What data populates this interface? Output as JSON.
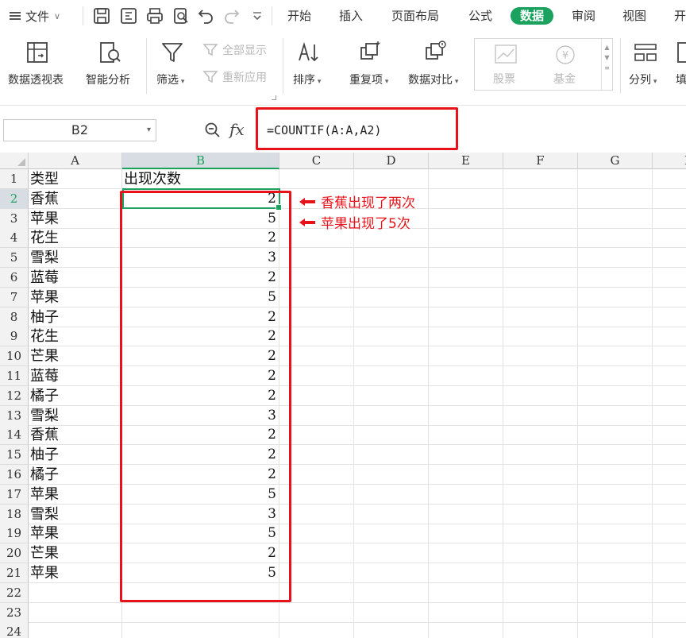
{
  "menubar": {
    "file_label": "文件",
    "tabs": [
      {
        "label": "开始",
        "active": false
      },
      {
        "label": "插入",
        "active": false
      },
      {
        "label": "页面布局",
        "active": false
      },
      {
        "label": "公式",
        "active": false
      },
      {
        "label": "数据",
        "active": true
      },
      {
        "label": "审阅",
        "active": false
      },
      {
        "label": "视图",
        "active": false
      },
      {
        "label": "开",
        "active": false
      }
    ],
    "quick_access_icons": [
      "save-icon",
      "export-icon",
      "print-icon",
      "print-preview-icon",
      "undo-icon",
      "redo-icon",
      "customize-icon"
    ]
  },
  "ribbon": {
    "pivot_label": "数据透视表",
    "smart_analysis_label": "智能分析",
    "filter_label": "筛选",
    "show_all_label": "全部显示",
    "reapply_label": "重新应用",
    "sort_label": "排序",
    "duplicates_label": "重复项",
    "compare_label": "数据对比",
    "stock_label": "股票",
    "fund_label": "基金",
    "split_label": "分列",
    "fill_label": "填"
  },
  "formula_bar": {
    "name_box": "B2",
    "fx_label": "fx",
    "formula": "=COUNTIF(A:A,A2)"
  },
  "sheet": {
    "columns": [
      "A",
      "B",
      "C",
      "D",
      "E",
      "F",
      "G",
      "H"
    ],
    "row_numbers": [
      "1",
      "2",
      "3",
      "4",
      "5",
      "6",
      "7",
      "8",
      "9",
      "10",
      "11",
      "12",
      "13",
      "14",
      "15",
      "16",
      "17",
      "18",
      "19",
      "20",
      "21",
      "22",
      "23",
      "24"
    ],
    "header": {
      "a": "类型",
      "b": "出现次数"
    },
    "rows": [
      {
        "a": "香蕉",
        "b": "2"
      },
      {
        "a": "苹果",
        "b": "5"
      },
      {
        "a": "花生",
        "b": "2"
      },
      {
        "a": "雪梨",
        "b": "3"
      },
      {
        "a": "蓝莓",
        "b": "2"
      },
      {
        "a": "苹果",
        "b": "5"
      },
      {
        "a": "柚子",
        "b": "2"
      },
      {
        "a": "花生",
        "b": "2"
      },
      {
        "a": "芒果",
        "b": "2"
      },
      {
        "a": "蓝莓",
        "b": "2"
      },
      {
        "a": "橘子",
        "b": "2"
      },
      {
        "a": "雪梨",
        "b": "3"
      },
      {
        "a": "香蕉",
        "b": "2"
      },
      {
        "a": "柚子",
        "b": "2"
      },
      {
        "a": "橘子",
        "b": "2"
      },
      {
        "a": "苹果",
        "b": "5"
      },
      {
        "a": "雪梨",
        "b": "3"
      },
      {
        "a": "苹果",
        "b": "5"
      },
      {
        "a": "芒果",
        "b": "2"
      },
      {
        "a": "苹果",
        "b": "5"
      }
    ]
  },
  "annotations": {
    "note1": "香蕉出现了两次",
    "note2": "苹果出现了5次",
    "color": "#e8121a"
  },
  "colors": {
    "accent": "#1aa25e",
    "annotation_red": "#e8121a"
  }
}
